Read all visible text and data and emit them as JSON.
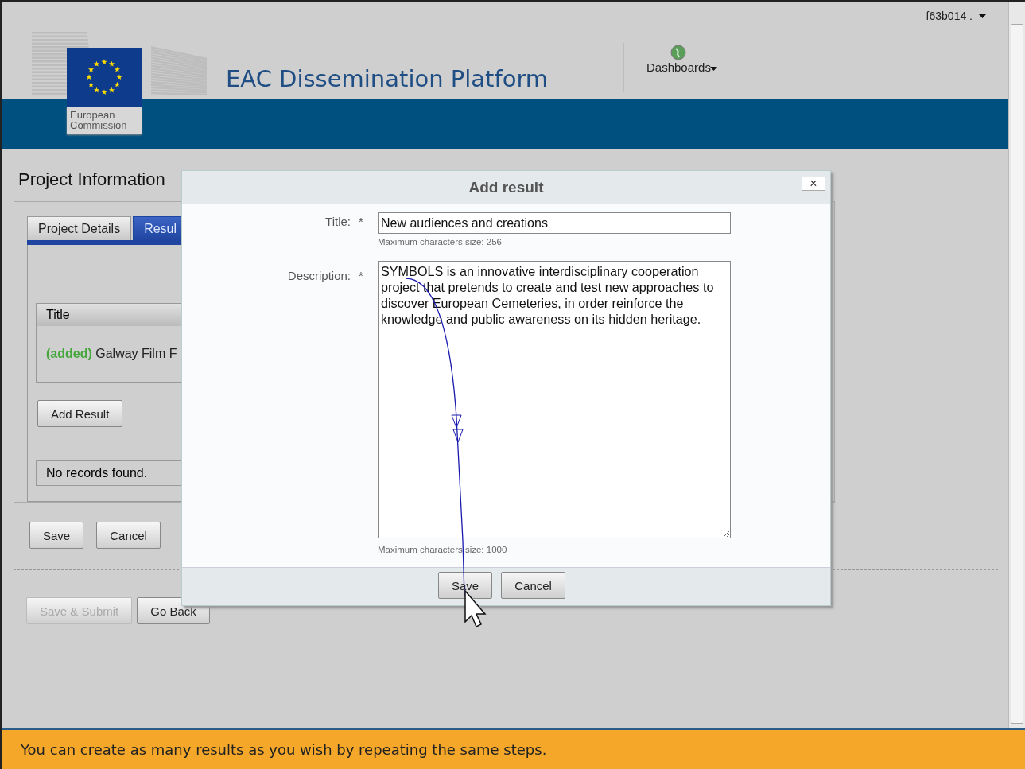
{
  "header": {
    "logo_caption": "European Commission",
    "app_title": "EAC Dissemination Platform",
    "user_menu": {
      "label": "f63b014 ."
    },
    "nav": [
      {
        "label": "Dashboards"
      }
    ]
  },
  "page": {
    "title": "Project Information",
    "tabs": [
      {
        "label": "Project Details",
        "selected": false
      },
      {
        "label": "Resul",
        "selected": true
      }
    ],
    "results_table": {
      "columns": [
        "Title"
      ],
      "rows": [
        {
          "status": "(added)",
          "title": "Galway Film F"
        }
      ]
    },
    "add_button": "Add Result",
    "empty_message": "No records found.",
    "form_buttons": [
      {
        "label": "Save",
        "disabled": false
      },
      {
        "label": "Cancel",
        "disabled": false
      }
    ],
    "footer_buttons": [
      {
        "label": "Save & Submit",
        "disabled": true
      },
      {
        "label": "Go Back",
        "disabled": false
      }
    ]
  },
  "dialog": {
    "title": "Add result",
    "close": "×",
    "fields": [
      {
        "kind": "input",
        "label": "Title:",
        "required_mark": "*",
        "value": "New audiences and creations",
        "hint": "Maximum characters size: 256"
      },
      {
        "kind": "textarea",
        "label": "Description:",
        "required_mark": "*",
        "value": "SYMBOLS is an innovative interdisciplinary cooperation project that pretends to create and test new approaches to discover European Cemeteries, in order reinforce the knowledge and public awareness on its hidden heritage.",
        "hint": "Maximum characters size: 1000"
      }
    ],
    "buttons": [
      {
        "label": "Save"
      },
      {
        "label": "Cancel"
      }
    ]
  },
  "tip": "You can create as many results as you wish by repeating the same steps."
}
